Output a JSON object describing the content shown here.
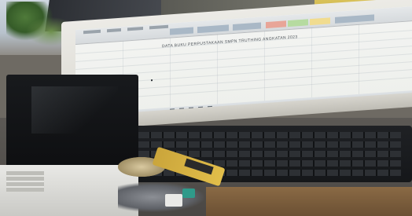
{
  "scene": {
    "description_free": true
  },
  "screen": {
    "sheet_title": "DATA BUKU PERPUSTAKAAN SMPN TRUTHING ANGKATAN 2023"
  },
  "colors": {
    "screen_bg": "#eef0ec",
    "keyboard": "#15171a",
    "laptop_lid": "#0e0f11",
    "usb_yellow": "#e2be4a"
  }
}
